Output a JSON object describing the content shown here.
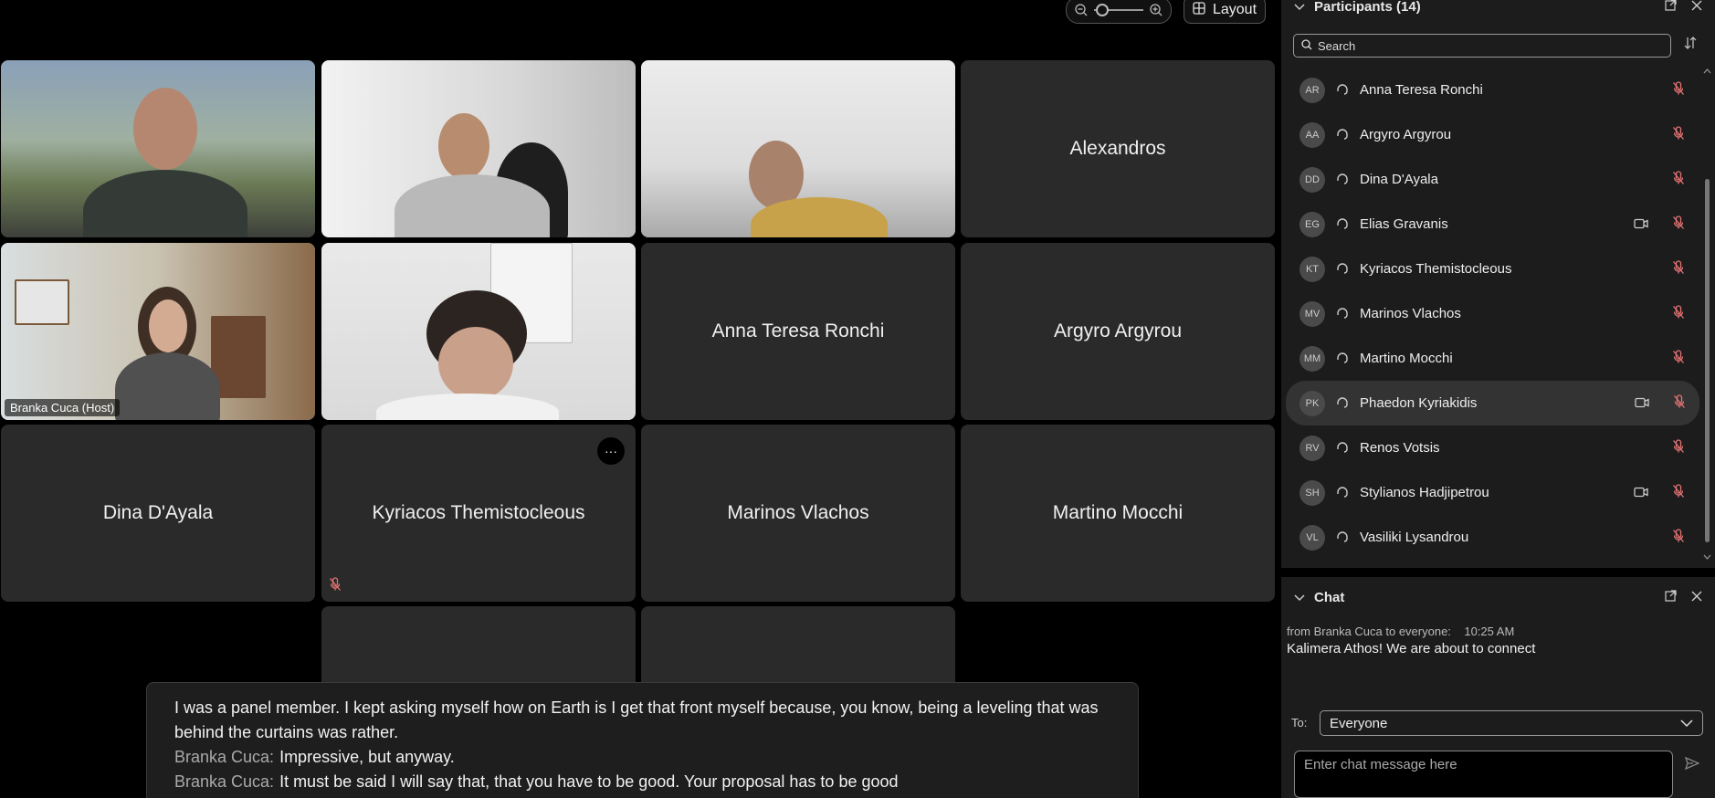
{
  "toolbar": {
    "layout_label": "Layout"
  },
  "grid": {
    "tiles": [
      {
        "name": "",
        "type": "video"
      },
      {
        "name": "",
        "type": "video"
      },
      {
        "name": "",
        "type": "video"
      },
      {
        "name": "Alexandros",
        "type": "name"
      },
      {
        "name": "Branka Cuca (Host)",
        "type": "video-active"
      },
      {
        "name": "",
        "type": "video"
      },
      {
        "name": "Anna Teresa Ronchi",
        "type": "name"
      },
      {
        "name": "Argyro Argyrou",
        "type": "name"
      },
      {
        "name": "Dina D'Ayala",
        "type": "name"
      },
      {
        "name": "Kyriacos Themistocleous",
        "type": "name"
      },
      {
        "name": "Marinos Vlachos",
        "type": "name"
      },
      {
        "name": "Martino Mocchi",
        "type": "name"
      }
    ],
    "more_label": "···"
  },
  "captions": {
    "line1": "I was a panel member. I kept asking myself how on Earth is I get that front myself because, you know, being a leveling that was behind the curtains was rather.",
    "line2_speaker": "Branka Cuca:",
    "line2_text": "Impressive, but anyway.",
    "line3_speaker": "Branka Cuca:",
    "line3_text": "It must be said I will say that, that you have to be good. Your proposal has to be good"
  },
  "participants": {
    "title": "Participants (14)",
    "search_placeholder": "Search",
    "list": [
      {
        "initials": "AR",
        "name": "Anna Teresa Ronchi",
        "camera": false
      },
      {
        "initials": "AA",
        "name": "Argyro Argyrou",
        "camera": false
      },
      {
        "initials": "DD",
        "name": "Dina D'Ayala",
        "camera": false
      },
      {
        "initials": "EG",
        "name": "Elias Gravanis",
        "camera": true
      },
      {
        "initials": "KT",
        "name": "Kyriacos Themistocleous",
        "camera": false
      },
      {
        "initials": "MV",
        "name": "Marinos Vlachos",
        "camera": false
      },
      {
        "initials": "MM",
        "name": "Martino Mocchi",
        "camera": false
      },
      {
        "initials": "PK",
        "name": "Phaedon Kyriakidis",
        "camera": true
      },
      {
        "initials": "RV",
        "name": "Renos Votsis",
        "camera": false
      },
      {
        "initials": "SH",
        "name": "Stylianos Hadjipetrou",
        "camera": true
      },
      {
        "initials": "VL",
        "name": "Vasiliki Lysandrou",
        "camera": false
      }
    ]
  },
  "chat": {
    "title": "Chat",
    "meta": "from Branka Cuca to everyone:    10:25 AM",
    "message": "Kalimera Athos! We are about to connect",
    "to_label": "To:",
    "to_value": "Everyone",
    "input_placeholder": "Enter chat message here"
  },
  "colors": {
    "accent_active_tile": "#64b5f6",
    "muted_mic": "#e57373"
  }
}
